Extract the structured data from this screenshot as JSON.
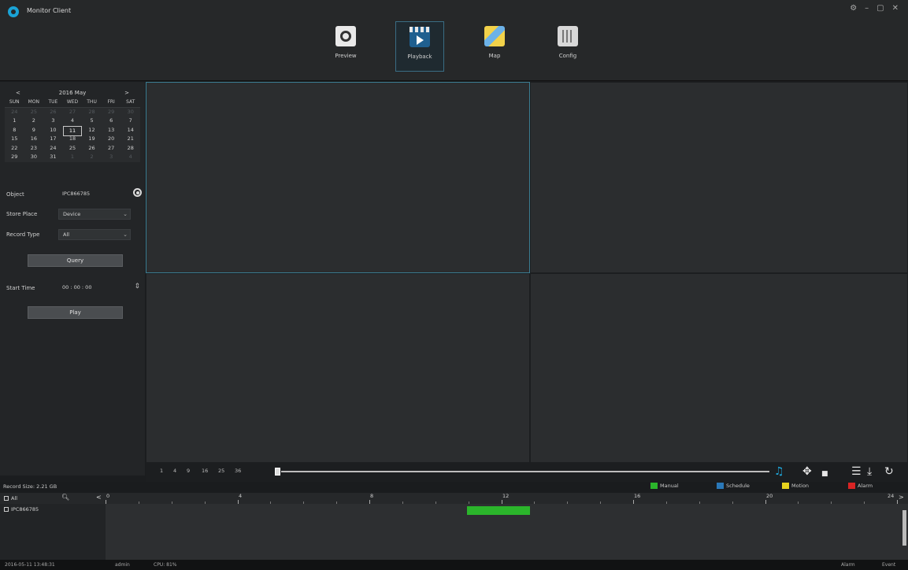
{
  "app": {
    "title": "Monitor Client"
  },
  "window_controls": [
    "⚙",
    "–",
    "▢",
    "✕"
  ],
  "nav": [
    {
      "label": "Preview",
      "icon": "preview-icon"
    },
    {
      "label": "Playback",
      "icon": "playback-icon"
    },
    {
      "label": "Map",
      "icon": "map-icon"
    },
    {
      "label": "Config",
      "icon": "config-icon"
    }
  ],
  "nav_active": "Playback",
  "calendar": {
    "prev": "<",
    "next": ">",
    "title": "2016  May",
    "weekdays": [
      "SUN",
      "MON",
      "TUE",
      "WED",
      "THU",
      "FRI",
      "SAT"
    ],
    "weeks": [
      [
        "24",
        "25",
        "26",
        "27",
        "28",
        "29",
        "30"
      ],
      [
        "1",
        "2",
        "3",
        "4",
        "5",
        "6",
        "7"
      ],
      [
        "8",
        "9",
        "10",
        "11",
        "12",
        "13",
        "14"
      ],
      [
        "15",
        "16",
        "17",
        "18",
        "19",
        "20",
        "21"
      ],
      [
        "22",
        "23",
        "24",
        "25",
        "26",
        "27",
        "28"
      ],
      [
        "29",
        "30",
        "31",
        "1",
        "2",
        "3",
        "4"
      ]
    ],
    "selected_day": "11"
  },
  "form": {
    "object_label": "Object",
    "object_value": "IPC866785",
    "store_place_label": "Store Place",
    "store_place_value": "Device",
    "record_type_label": "Record Type",
    "record_type_value": "All",
    "query_button": "Query",
    "start_time_label": "Start Time",
    "start_time_value": "00 : 00 : 00",
    "play_button": "Play"
  },
  "controls": {
    "layout_numbers": [
      "1",
      "4",
      "9",
      "16",
      "25",
      "36"
    ]
  },
  "timeline": {
    "record_size": "Record Size: 2.21 GB",
    "legend": [
      {
        "label": "Manual",
        "color": "#2bb52b"
      },
      {
        "label": "Schedule",
        "color": "#2a78b8"
      },
      {
        "label": "Motion",
        "color": "#e6d21e"
      },
      {
        "label": "Alarm",
        "color": "#d82424"
      }
    ],
    "all_label": "All",
    "channel_label": "IPC866785",
    "tick_labels": [
      "0",
      "4",
      "8",
      "12",
      "16",
      "20",
      "24"
    ],
    "prev": "<",
    "next": ">",
    "record_segment_hours": [
      10.9,
      12.8
    ]
  },
  "status": {
    "datetime": "2016-05-11 13:48:31",
    "user": "admin",
    "cpu": "CPU: 81%",
    "alarm_tab": "Alarm",
    "event_tab": "Event"
  }
}
